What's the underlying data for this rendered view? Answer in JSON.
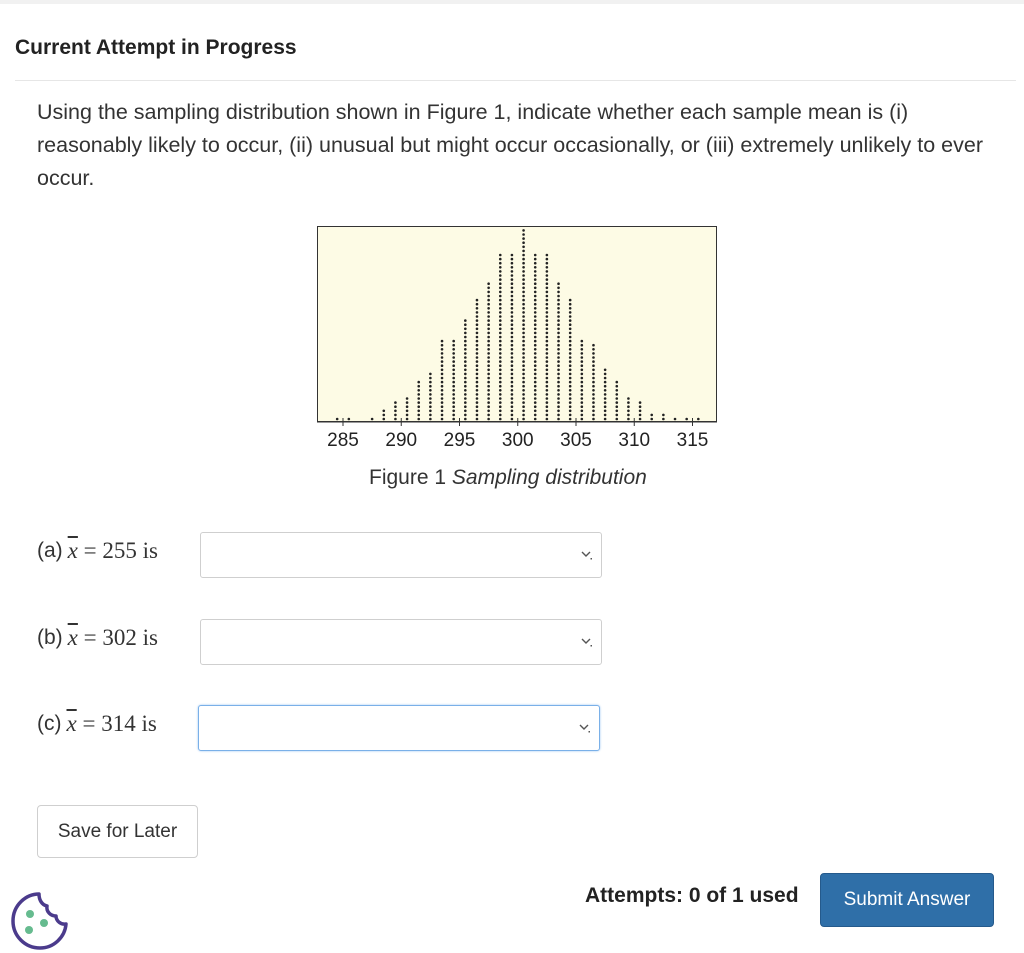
{
  "header": {
    "title": "Current Attempt in Progress"
  },
  "question": {
    "text": "Using the sampling distribution shown in Figure 1, indicate whether each sample mean is (i) reasonably likely to occur, (ii) unusual but might occur occasionally, or (iii) extremely unlikely to ever occur."
  },
  "figure": {
    "caption_prefix": "Figure 1",
    "caption_italic": "Sampling distribution"
  },
  "chart_data": {
    "type": "scatter",
    "style": "dotplot",
    "title": "",
    "xlabel": "",
    "ylabel": "",
    "xlim": [
      282,
      318
    ],
    "x_ticks": [
      285,
      290,
      295,
      300,
      305,
      310,
      315
    ],
    "x": [
      284.5,
      285.5,
      287.5,
      288.5,
      289.5,
      290.5,
      291.5,
      292.5,
      293.5,
      294.5,
      295.5,
      296.5,
      297.5,
      298.5,
      299.5,
      300.5,
      301.5,
      302.5,
      303.5,
      304.5,
      305.5,
      306.5,
      307.5,
      308.5,
      309.5,
      310.5,
      311.5,
      312.5,
      313.5,
      314.5,
      315.5
    ],
    "counts": [
      1,
      1,
      1,
      3,
      5,
      6,
      10,
      12,
      20,
      20,
      25,
      30,
      34,
      41,
      41,
      47,
      41,
      41,
      34,
      30,
      20,
      19,
      13,
      10,
      6,
      5,
      2,
      2,
      1,
      1,
      1
    ],
    "background_color": "#fdfbe5",
    "dot_color": "#222222"
  },
  "parts": [
    {
      "label": "(a)",
      "math_var": "x",
      "math_rest": " = 255 is",
      "select_value": ""
    },
    {
      "label": "(b)",
      "math_var": "x",
      "math_rest": " = 302 is",
      "select_value": ""
    },
    {
      "label": "(c)",
      "math_var": "x",
      "math_rest": " = 314 is",
      "select_value": ""
    }
  ],
  "buttons": {
    "save_label": "Save for Later",
    "submit_label": "Submit Answer"
  },
  "attempts": {
    "text": "Attempts: 0 of 1 used"
  },
  "colors": {
    "submit": "#2f6fa8",
    "focus_border": "#7ab0e8",
    "cookie_icon": "#4b3b8c",
    "cookie_dots": "#66bb8f"
  },
  "icons": {
    "select_chevron": "chevron-down-icon",
    "cookie": "cookie-icon"
  }
}
